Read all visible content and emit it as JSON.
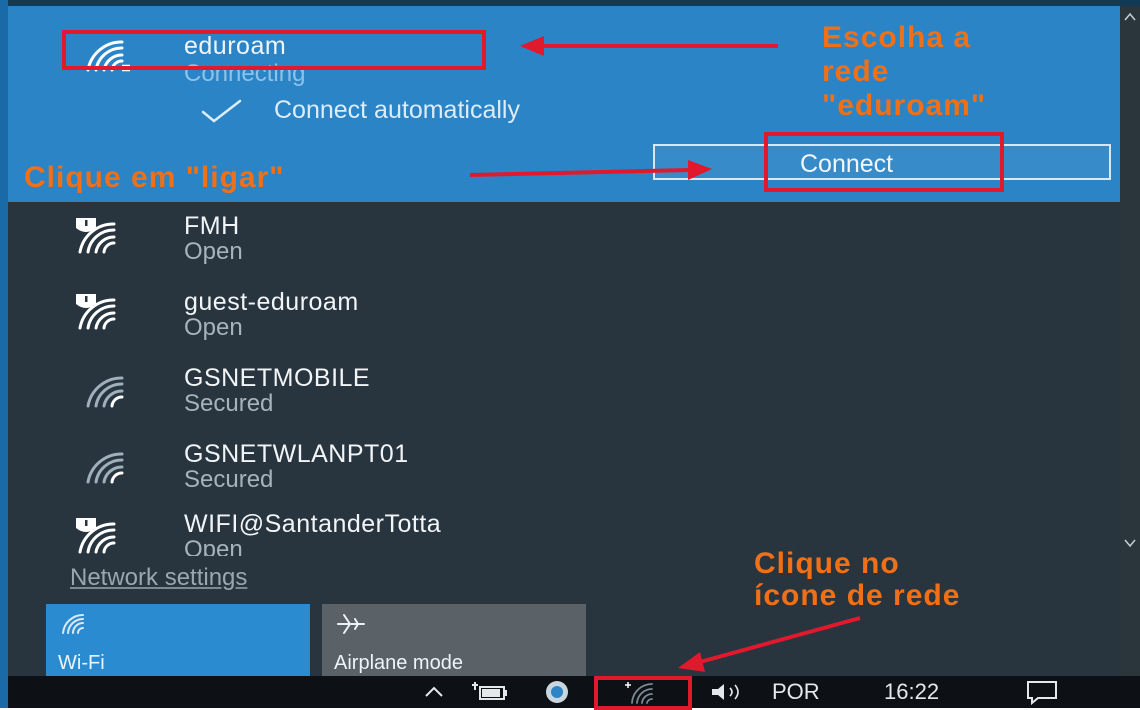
{
  "colors": {
    "selected_panel": "#2b84c6",
    "flyout_bg": "#28353f",
    "quick_action_active": "#2a8bd0",
    "quick_action_inactive": "#5a6167",
    "taskbar": "#0d1014",
    "annotation_text": "#f07018",
    "annotation_box": "#e0192c"
  },
  "selected_network": {
    "ssid": "eduroam",
    "status": "Connecting",
    "connect_automatically": "Connect automatically",
    "connect_button": "Connect",
    "icon": "wifi-icon"
  },
  "networks": [
    {
      "ssid": "FMH",
      "status": "Open",
      "icon": "wifi-open-warning-icon"
    },
    {
      "ssid": "guest-eduroam",
      "status": "Open",
      "icon": "wifi-open-warning-icon"
    },
    {
      "ssid": "GSNETMOBILE",
      "status": "Secured",
      "icon": "wifi-icon"
    },
    {
      "ssid": "GSNETWLANPT01",
      "status": "Secured",
      "icon": "wifi-icon"
    },
    {
      "ssid": "WIFI@SantanderTotta",
      "status": "Open",
      "icon": "wifi-open-warning-icon"
    }
  ],
  "network_settings": "Network settings",
  "quick_actions": [
    {
      "label": "Wi-Fi",
      "icon": "wifi-icon",
      "active": true
    },
    {
      "label": "Airplane mode",
      "icon": "airplane-icon",
      "active": false
    }
  ],
  "taskbar": {
    "language": "POR",
    "time": "16:22",
    "icons": [
      "chevron-up-icon",
      "battery-icon",
      "app-icon",
      "network-icon",
      "volume-icon",
      "notification-icon"
    ]
  },
  "annotations": {
    "choose_network": [
      "Escolha a",
      "rede",
      "\"eduroam\""
    ],
    "click_connect": "Clique em \"ligar\"",
    "click_network_icon": [
      "Clique no",
      "ícone de rede"
    ]
  }
}
